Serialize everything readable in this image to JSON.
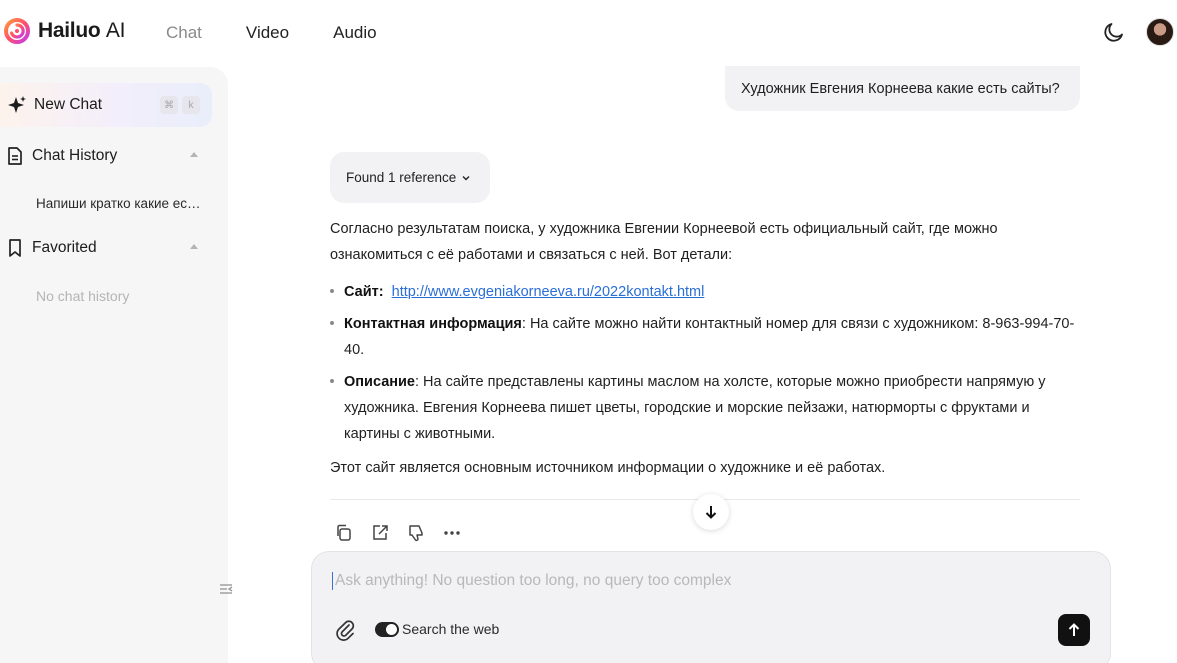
{
  "brand": {
    "name": "Hailuo",
    "suffix": "AI"
  },
  "nav": {
    "items": [
      {
        "label": "Chat",
        "dim": true
      },
      {
        "label": "Video",
        "dim": false
      },
      {
        "label": "Audio",
        "dim": false
      }
    ]
  },
  "header": {
    "theme_icon": "moon-icon"
  },
  "sidebar": {
    "new_chat": {
      "label": "New Chat",
      "shortcut": [
        "⌘",
        "k"
      ]
    },
    "chat_history": {
      "label": "Chat History",
      "items": [
        "Напиши кратко какие есть сайты у Художник Евгения Корнеева"
      ]
    },
    "favorited": {
      "label": "Favorited",
      "empty_text": "No chat history"
    }
  },
  "chat": {
    "user_message": "Художник Евгения Корнеева какие есть сайты?",
    "reference_chip": "Found 1 reference",
    "answer": {
      "intro": "Согласно результатам поиска, у художника Евгении Корнеевой есть официальный сайт, где можно ознакомиться с её работами и связаться с ней. Вот детали:",
      "bullets": [
        {
          "title": "Сайт:",
          "link": "http://www.evgeniakorneeva.ru/2022kontakt.html",
          "text": ""
        },
        {
          "title": "Контактная информация",
          "link": "",
          "text": ": На сайте можно найти контактный номер для связи с художником: 8-963-994-70-40."
        },
        {
          "title": "Описание",
          "link": "",
          "text": ": На сайте представлены картины маслом на холсте, которые можно приобрести напрямую у художника. Евгения Корнеева пишет цветы, городские и морские пейзажи, натюрморты с фруктами и картины с животными."
        }
      ],
      "conclusion": "Этот сайт является основным источником информации о художнике и её работах."
    }
  },
  "composer": {
    "placeholder": "Ask anything! No question too long, no query too complex",
    "value": "",
    "web_search_label": "Search the web",
    "web_search_enabled": true
  },
  "colors": {
    "link": "#2a6fd6",
    "send_button": "#111111",
    "sidebar_bg": "#f6f6f7"
  }
}
